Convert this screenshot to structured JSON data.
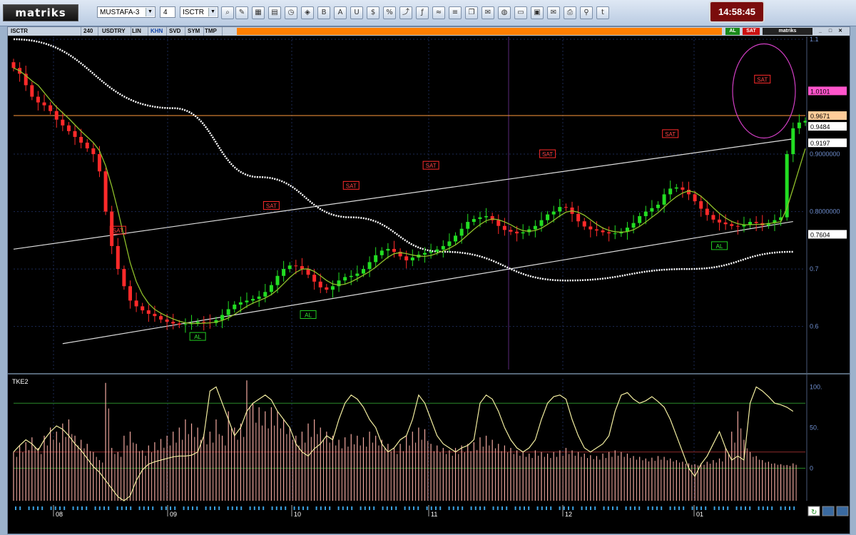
{
  "toolbar": {
    "logo": "matriks",
    "profile": "MUSTAFA-3",
    "page_num": "4",
    "symbol": "ISCTR",
    "clock": "14:58:45"
  },
  "window": {
    "tabs": [
      "ISCTR",
      "240",
      "USDTRY",
      "LIN",
      "KHN",
      "SVD",
      "SYM",
      "TMP"
    ],
    "al_button": "AL",
    "sat_button": "SAT",
    "brand": "matriks"
  },
  "chart_data": [
    {
      "type": "candlestick",
      "title": "",
      "y_ticks": [
        "1.1",
        "0.9000000",
        "0.8000000",
        "0.7",
        "0.6"
      ],
      "ylim": [
        0.525,
        1.105
      ],
      "x_ticks": [
        "08",
        "09",
        "10",
        "11",
        "12",
        "01"
      ],
      "price_labels": [
        {
          "value": 1.0101,
          "text": "1.0101",
          "color": "#ff55cc"
        },
        {
          "value": 0.9671,
          "text": "0.9671",
          "color": "#ffaa55"
        },
        {
          "value": 0.9484,
          "text": "0.9484",
          "color": "#ffffff"
        },
        {
          "value": 0.9197,
          "text": "0.9197",
          "color": "#ffffff"
        },
        {
          "value": 0.7604,
          "text": "0.7604",
          "color": "#ffffff"
        }
      ],
      "horizontal_line": 0.9671,
      "close_series": [
        1.05,
        1.04,
        1.02,
        1.0,
        0.99,
        0.985,
        0.975,
        0.96,
        0.95,
        0.94,
        0.93,
        0.92,
        0.91,
        0.9,
        0.87,
        0.8,
        0.74,
        0.7,
        0.67,
        0.645,
        0.635,
        0.628,
        0.622,
        0.618,
        0.612,
        0.608,
        0.605,
        0.603,
        0.604,
        0.606,
        0.608,
        0.607,
        0.606,
        0.611,
        0.62,
        0.63,
        0.638,
        0.642,
        0.645,
        0.648,
        0.652,
        0.66,
        0.672,
        0.688,
        0.7,
        0.706,
        0.705,
        0.7,
        0.69,
        0.678,
        0.668,
        0.664,
        0.67,
        0.68,
        0.686,
        0.688,
        0.692,
        0.7,
        0.712,
        0.724,
        0.732,
        0.735,
        0.73,
        0.722,
        0.715,
        0.72,
        0.725,
        0.728,
        0.73,
        0.734,
        0.74,
        0.748,
        0.758,
        0.77,
        0.782,
        0.787,
        0.79,
        0.792,
        0.785,
        0.775,
        0.768,
        0.765,
        0.762,
        0.764,
        0.769,
        0.775,
        0.785,
        0.795,
        0.8,
        0.808,
        0.807,
        0.796,
        0.783,
        0.774,
        0.769,
        0.767,
        0.764,
        0.762,
        0.762,
        0.765,
        0.772,
        0.78,
        0.792,
        0.8,
        0.806,
        0.812,
        0.83,
        0.84,
        0.842,
        0.838,
        0.83,
        0.818,
        0.805,
        0.794,
        0.786,
        0.781,
        0.778,
        0.775,
        0.774,
        0.777,
        0.782,
        0.78,
        0.776,
        0.78,
        0.785,
        0.79,
        0.9,
        0.945,
        0.955,
        0.958
      ],
      "ma_white": {
        "x": [
          0,
          26,
          40,
          55,
          70,
          90,
          110,
          127
        ],
        "y": [
          1.1,
          0.98,
          0.86,
          0.79,
          0.73,
          0.68,
          0.7,
          0.73
        ]
      },
      "trendlines": [
        {
          "x": [
            0,
            127
          ],
          "y": [
            0.7345,
            0.9265
          ]
        },
        {
          "x": [
            8,
            127
          ],
          "y": [
            0.57,
            0.7826
          ]
        }
      ],
      "signals": [
        {
          "text": "SAT",
          "type": "sell",
          "x": 17,
          "y": 0.767
        },
        {
          "text": "SAT",
          "type": "sell",
          "x": 42,
          "y": 0.81
        },
        {
          "text": "SAT",
          "type": "sell",
          "x": 55,
          "y": 0.845
        },
        {
          "text": "SAT",
          "type": "sell",
          "x": 68,
          "y": 0.88
        },
        {
          "text": "SAT",
          "type": "sell",
          "x": 87,
          "y": 0.9
        },
        {
          "text": "SAT",
          "type": "sell",
          "x": 107,
          "y": 0.935
        },
        {
          "text": "SAT",
          "type": "sell",
          "x": 122,
          "y": 1.03
        },
        {
          "text": "AL",
          "type": "buy",
          "x": 30,
          "y": 0.582
        },
        {
          "text": "AL",
          "type": "buy",
          "x": 48,
          "y": 0.62
        },
        {
          "text": "AL",
          "type": "buy",
          "x": 115,
          "y": 0.74
        }
      ]
    },
    {
      "type": "line",
      "title": "TKE2",
      "y_ticks": [
        "100.",
        "50.",
        "0"
      ],
      "ylim": [
        -40,
        110
      ],
      "levels": [
        80,
        20,
        0
      ],
      "series": [
        {
          "values": [
            20,
            28,
            35,
            30,
            22,
            35,
            45,
            52,
            48,
            40,
            30,
            22,
            12,
            2,
            -5,
            -15,
            -25,
            -35,
            -40,
            -34,
            -15,
            -2,
            5,
            8,
            10,
            12,
            14,
            15,
            15,
            16,
            20,
            40,
            95,
            100,
            80,
            60,
            40,
            50,
            70,
            80,
            85,
            90,
            84,
            70,
            60,
            50,
            30,
            20,
            15,
            24,
            30,
            40,
            35,
            60,
            80,
            90,
            85,
            75,
            60,
            50,
            30,
            20,
            25,
            35,
            40,
            60,
            90,
            80,
            60,
            40,
            30,
            25,
            20,
            25,
            28,
            35,
            80,
            90,
            85,
            70,
            50,
            35,
            25,
            20,
            25,
            35,
            60,
            80,
            88,
            90,
            85,
            60,
            40,
            25,
            20,
            25,
            30,
            40,
            70,
            90,
            93,
            85,
            80,
            83,
            88,
            82,
            75,
            60,
            40,
            20,
            0,
            -10,
            5,
            15,
            30,
            45,
            25,
            10,
            15,
            10,
            80,
            100,
            95,
            88,
            80,
            78,
            75,
            70
          ]
        },
        {
          "values": [
            20,
            28,
            32,
            38,
            25,
            40,
            50,
            45,
            55,
            60,
            40,
            35,
            30,
            20,
            10,
            105,
            25,
            20,
            40,
            45,
            30,
            22,
            28,
            32,
            36,
            40,
            45,
            50,
            60,
            55,
            50,
            42,
            45,
            60,
            40,
            70,
            50,
            55,
            108,
            80,
            75,
            70,
            75,
            70,
            60,
            50,
            40,
            45,
            55,
            60,
            50,
            45,
            40,
            35,
            38,
            42,
            40,
            38,
            45,
            40,
            35,
            30,
            25,
            30,
            40,
            45,
            50,
            48,
            30,
            28,
            25,
            22,
            25,
            28,
            30,
            32,
            38,
            40,
            35,
            30,
            28,
            25,
            22,
            20,
            18,
            22,
            20,
            18,
            20,
            22,
            25,
            22,
            20,
            18,
            16,
            15,
            18,
            20,
            22,
            20,
            18,
            15,
            14,
            12,
            13,
            15,
            14,
            12,
            10,
            8,
            6,
            5,
            6,
            8,
            10,
            12,
            25,
            45,
            70,
            35,
            20,
            15,
            10,
            8,
            6,
            5,
            4,
            6
          ]
        }
      ]
    }
  ]
}
